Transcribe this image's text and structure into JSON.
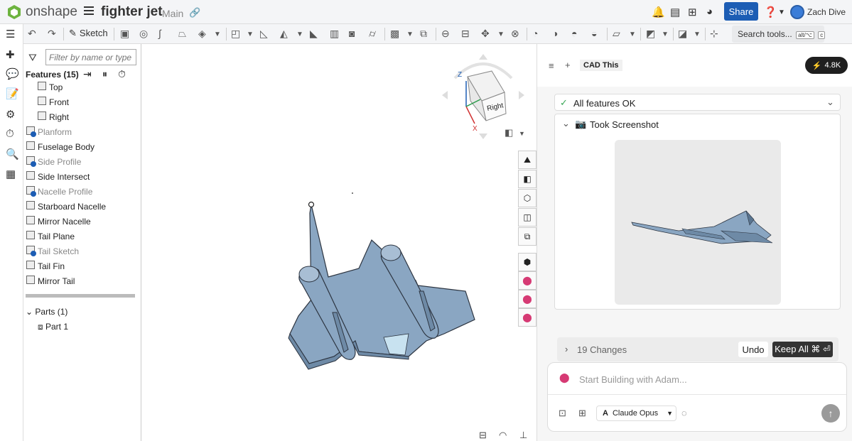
{
  "app": {
    "brand": "onshape",
    "doc_title": "fighter jet",
    "branch": "Main"
  },
  "header": {
    "share_label": "Share",
    "user_name": "Zach Dive",
    "help_label": "?"
  },
  "toolbar": {
    "sketch_label": "Sketch",
    "search_label": "Search tools...",
    "kbd1": "alt/⌥",
    "kbd2": "c"
  },
  "features": {
    "filter_placeholder": "Filter by name or type",
    "header": "Features (15)",
    "items": [
      {
        "label": "Top",
        "dim": false
      },
      {
        "label": "Front",
        "dim": false
      },
      {
        "label": "Right",
        "dim": false
      },
      {
        "label": "Planform",
        "dim": true
      },
      {
        "label": "Fuselage Body",
        "dim": false
      },
      {
        "label": "Side Profile",
        "dim": true
      },
      {
        "label": "Side Intersect",
        "dim": false
      },
      {
        "label": "Nacelle Profile",
        "dim": true
      },
      {
        "label": "Starboard Nacelle",
        "dim": false
      },
      {
        "label": "Mirror Nacelle",
        "dim": false
      },
      {
        "label": "Tail Plane",
        "dim": false
      },
      {
        "label": "Tail Sketch",
        "dim": true
      },
      {
        "label": "Tail Fin",
        "dim": false
      },
      {
        "label": "Mirror Tail",
        "dim": false
      }
    ],
    "parts_header": "Parts (1)",
    "part_label": "Part 1"
  },
  "navcube": {
    "face_label": "Right",
    "axis_z": "Z",
    "axis_x": "X"
  },
  "adam": {
    "cad_this": "CAD This",
    "count_badge": "4.8K",
    "status_ok": "All features OK",
    "screenshot_label": "Took Screenshot",
    "changes_label": "19 Changes",
    "undo_label": "Undo",
    "keep_label": "Keep All ⌘ ⏎",
    "chat_placeholder": "Start Building with Adam...",
    "model_label": "Claude Opus"
  },
  "colors": {
    "accent": "#1c5db4",
    "part_fill": "#8aa6c2",
    "part_stroke": "#2c3440"
  }
}
